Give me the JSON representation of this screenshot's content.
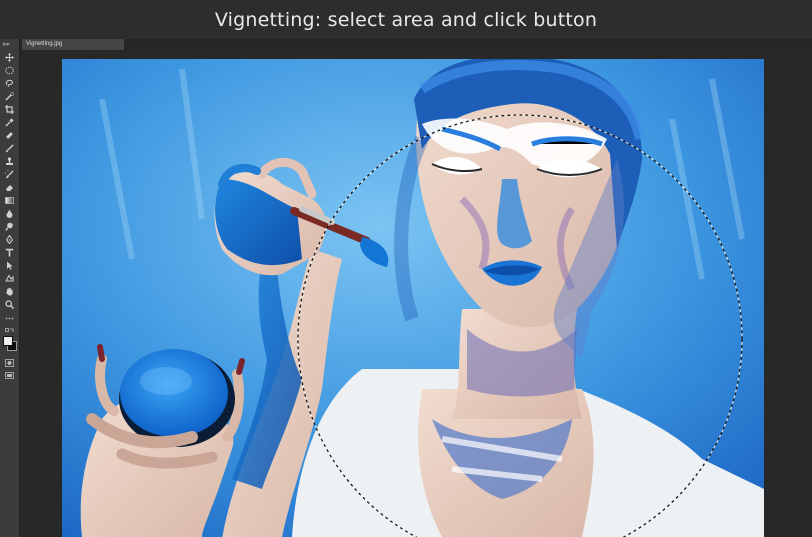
{
  "caption": {
    "text": "Vignetting: select area and click button"
  },
  "document": {
    "tab_label": "Vignetting.jpg"
  },
  "toolbar": {
    "grip_glyph": "▸▸",
    "tools": [
      {
        "name": "move-tool-icon"
      },
      {
        "name": "marquee-tool-icon"
      },
      {
        "name": "lasso-tool-icon"
      },
      {
        "name": "quick-select-tool-icon"
      },
      {
        "name": "crop-tool-icon"
      },
      {
        "name": "eyedropper-tool-icon"
      },
      {
        "name": "healing-brush-tool-icon"
      },
      {
        "name": "brush-tool-icon"
      },
      {
        "name": "clone-stamp-tool-icon"
      },
      {
        "name": "history-brush-tool-icon"
      },
      {
        "name": "eraser-tool-icon"
      },
      {
        "name": "gradient-tool-icon"
      },
      {
        "name": "blur-tool-icon"
      },
      {
        "name": "dodge-tool-icon"
      },
      {
        "name": "pen-tool-icon"
      },
      {
        "name": "type-tool-icon"
      },
      {
        "name": "path-select-tool-icon"
      },
      {
        "name": "shape-tool-icon"
      },
      {
        "name": "hand-tool-icon"
      },
      {
        "name": "zoom-tool-icon"
      },
      {
        "name": "more-tools-icon"
      }
    ],
    "foreground_color": "#f0f0f0",
    "background_color": "#111111"
  },
  "colors": {
    "caption_bg": "#2d2d2d",
    "workspace_bg": "#282828",
    "photo_backdrop": "#3a8fd8",
    "accent_blue": "#1e7fd6"
  }
}
